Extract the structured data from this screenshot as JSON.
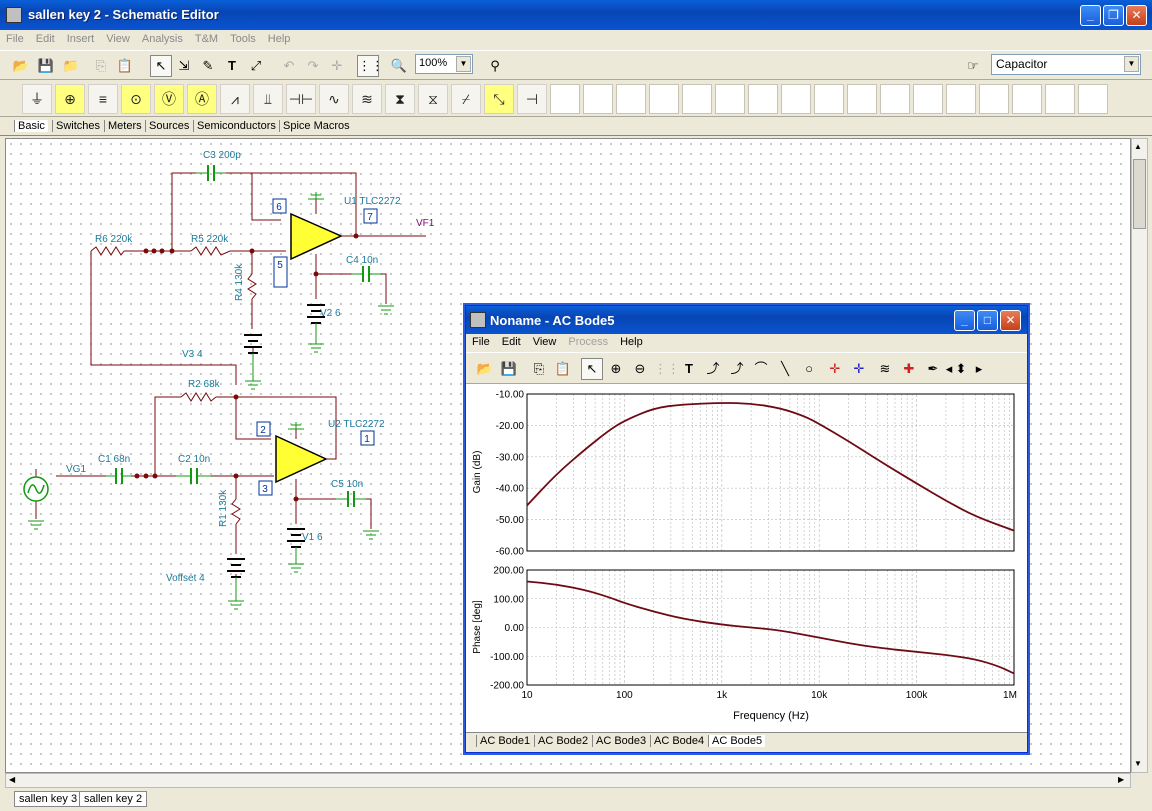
{
  "window": {
    "title": "sallen key 2 - Schematic Editor"
  },
  "menu": [
    "File",
    "Edit",
    "Insert",
    "View",
    "Analysis",
    "T&M",
    "Tools",
    "Help"
  ],
  "toolbar": {
    "zoom": "100%",
    "component_select": "Capacitor"
  },
  "component_tabs": [
    "Basic",
    "Switches",
    "Meters",
    "Sources",
    "Semiconductors",
    "Spice Macros"
  ],
  "schematic": {
    "labels": {
      "c3": "C3 200p",
      "u1": "U1 TLC2272",
      "pin6": "6",
      "pin7": "7",
      "pin5": "5",
      "vf1": "VF1",
      "r6": "R6 220k",
      "r5": "R5 220k",
      "r4": "R4 130k",
      "c4": "C4 10n",
      "v2": "V2 6",
      "v3": "V3 4",
      "r2": "R2 68k",
      "u2": "U2 TLC2272",
      "pin2": "2",
      "pin1": "1",
      "pin3": "3",
      "vg1": "VG1",
      "c1": "C1 68n",
      "c2": "C2 10n",
      "c5": "C5 10n",
      "r1": "R1 130k",
      "v1": "V1 6",
      "voffset": "Voffset 4"
    }
  },
  "document_tabs": [
    "sallen key 3",
    "sallen key 2"
  ],
  "bode_window": {
    "title": "Noname - AC Bode5",
    "menu": [
      {
        "label": "File",
        "enabled": true
      },
      {
        "label": "Edit",
        "enabled": true
      },
      {
        "label": "View",
        "enabled": true
      },
      {
        "label": "Process",
        "enabled": false
      },
      {
        "label": "Help",
        "enabled": true
      }
    ],
    "tabs": [
      "AC Bode1",
      "AC Bode2",
      "AC Bode3",
      "AC Bode4",
      "AC Bode5"
    ],
    "colors": {
      "trace": "#6e0a14",
      "grid": "#b8b8b8"
    }
  },
  "chart_data": [
    {
      "type": "line",
      "title": "",
      "xlabel": "Frequency (Hz)",
      "ylabel": "Gain (dB)",
      "xscale": "log",
      "xlim": [
        10,
        1000000
      ],
      "ylim": [
        -60,
        -10
      ],
      "x_tick_labels": [
        "10",
        "100",
        "1k",
        "10k",
        "100k",
        "1M"
      ],
      "y_tick_labels": [
        "-10.00",
        "-20.00",
        "-30.00",
        "-40.00",
        "-50.00",
        "-60.00"
      ],
      "grid": true,
      "x": [
        10,
        20,
        40,
        70,
        100,
        200,
        400,
        1000,
        2000,
        4000,
        7000,
        10000,
        20000,
        40000,
        100000,
        200000,
        400000,
        1000000
      ],
      "y": [
        -45.5,
        -35.5,
        -27.5,
        -21.5,
        -18.5,
        -14.5,
        -13.3,
        -12.8,
        -13.0,
        -14.5,
        -17.0,
        -19.5,
        -25.0,
        -31.0,
        -38.5,
        -44.0,
        -49.0,
        -53.5
      ]
    },
    {
      "type": "line",
      "title": "",
      "xlabel": "Frequency (Hz)",
      "ylabel": "Phase [deg]",
      "xscale": "log",
      "xlim": [
        10,
        1000000
      ],
      "ylim": [
        -200,
        200
      ],
      "x_tick_labels": [
        "10",
        "100",
        "1k",
        "10k",
        "100k",
        "1M"
      ],
      "y_tick_labels": [
        "200.00",
        "100.00",
        "0.00",
        "-100.00",
        "-200.00"
      ],
      "grid": true,
      "x": [
        10,
        20,
        40,
        70,
        100,
        200,
        400,
        1000,
        2000,
        4000,
        10000,
        20000,
        40000,
        100000,
        200000,
        400000,
        700000,
        1000000
      ],
      "y": [
        160,
        150,
        130,
        105,
        85,
        55,
        30,
        10,
        0,
        -10,
        -35,
        -55,
        -70,
        -85,
        -95,
        -110,
        -135,
        -160
      ]
    }
  ]
}
